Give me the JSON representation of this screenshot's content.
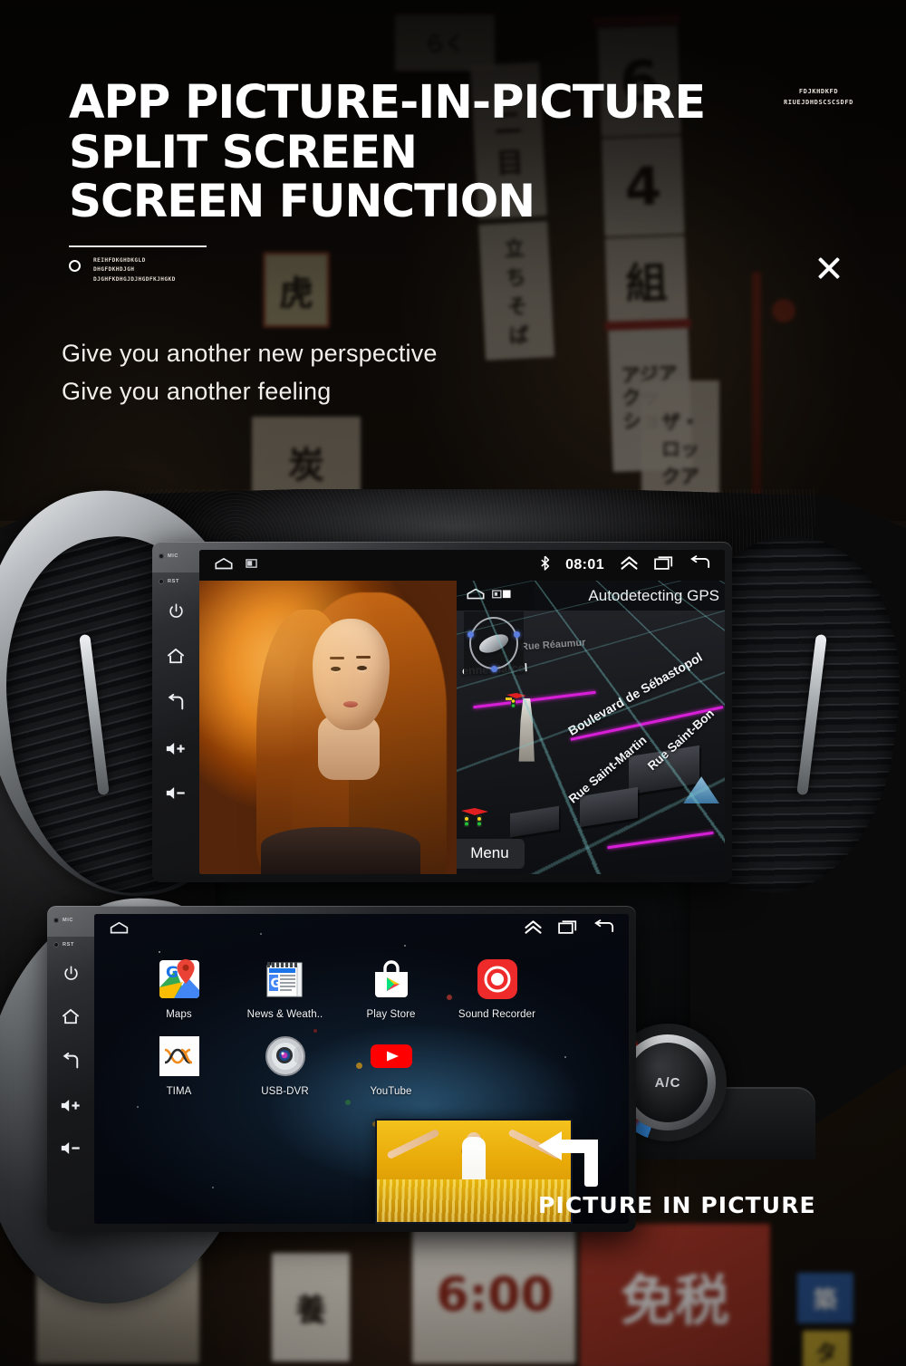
{
  "hero": {
    "title_line1": "APP PICTURE-IN-PICTURE",
    "title_line2": "SPLIT SCREEN",
    "title_line3": "SCREEN FUNCTION",
    "micro_line1": "REIHFDKGHDKGLD",
    "micro_line2": "DHGFDKHDJGH",
    "micro_line3": "DJGHFKDHGJDJHGDFKJHGKD",
    "subtitle_line1": "Give you another new perspective",
    "subtitle_line2": "Give you another feeling",
    "corner_code_line1": "FDJKHDKFD",
    "corner_code_line2": "RIUEJDHDSCSCSDFD",
    "close_icon": "close-icon"
  },
  "side_rail": {
    "mic_label": "MIC",
    "rst_label": "RST",
    "buttons": [
      "power-icon",
      "home-icon",
      "back-icon",
      "volume-up-icon",
      "volume-down-icon"
    ]
  },
  "top_unit": {
    "statusbar": {
      "home_icon": "home-icon",
      "screenshot_icon": "screenshot-icon",
      "bluetooth_icon": "bluetooth-icon",
      "clock": "08:01",
      "chevron_up_icon": "chevron-up-icon",
      "recents_icon": "recents-icon",
      "back_icon": "back-icon"
    },
    "left_pane": {
      "name": "video-player-pane"
    },
    "right_pane": {
      "name": "gps-navigation-pane",
      "banner": "Autodetecting GPS",
      "menu_button": "Menu",
      "labels": [
        "enne Marcel",
        "Boulevard de Sébastopol",
        "Rue Saint-Martin",
        "Rue Saint-Bon"
      ],
      "mini_status": {
        "home_icon": "home-icon",
        "screenshot_icon": "screenshot-icon"
      },
      "compass_icon": "satellite-dish-icon"
    }
  },
  "bottom_unit": {
    "statusbar": {
      "home_icon": "home-icon",
      "chevron_up_icon": "chevron-up-icon",
      "recents_icon": "recents-icon",
      "back_icon": "back-icon"
    },
    "apps": [
      {
        "label": "Maps",
        "icon": "google-maps-icon"
      },
      {
        "label": "News & Weath..",
        "icon": "google-news-icon"
      },
      {
        "label": "Play Store",
        "icon": "play-store-icon"
      },
      {
        "label": "Sound Recorder",
        "icon": "sound-recorder-icon"
      },
      {
        "label": "TIMA",
        "icon": "tima-icon"
      },
      {
        "label": "USB-DVR",
        "icon": "usb-dvr-icon"
      },
      {
        "label": "YouTube",
        "icon": "youtube-icon"
      }
    ],
    "pip_window": {
      "name": "picture-in-picture-window"
    }
  },
  "callout": {
    "arrow_icon": "arrow-left-turn-icon",
    "text": "PICTURE IN PICTURE"
  },
  "dashboard": {
    "ac_knob_label": "A/C",
    "left_vent": "air-vent-left",
    "right_vent": "air-vent-right"
  },
  "colors": {
    "accent_white": "#ffffff",
    "bluetooth_blue": "#ffffff",
    "map_grid": "#78c8c8",
    "map_route": "#d61fd6",
    "pip_yellow": "#e8a908",
    "youtube_red": "#ff0000",
    "recorder_red": "#ef2a2a"
  }
}
